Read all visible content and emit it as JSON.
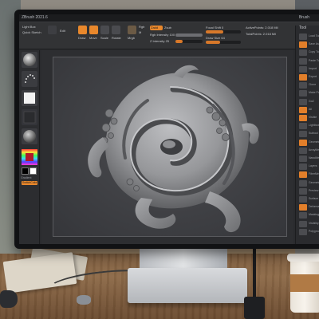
{
  "app": {
    "title": "ZBrush 2021.6",
    "menu_right": "Brush"
  },
  "toolbar": {
    "left_labels": [
      "Light Box",
      "Quick Sketch"
    ],
    "edit_label": "Edit",
    "draw_label": "Draw",
    "move_label": "Move",
    "scale_label": "Scale",
    "rotate_label": "Rotate",
    "mrgb_label": "Mrgb",
    "rgb_label": "Rgb",
    "m_label": "M",
    "zadd_label": "Zadd",
    "zsub_label": "Zsub",
    "focal_shift_label": "Focal Shift 0",
    "draw_size_label": "Draw Size 64",
    "rgb_intensity_label": "Rgb Intensity 100",
    "z_intensity_label": "Z Intensity 25",
    "active_points_label": "ActivePoints: 2.018 Mil",
    "total_points_label": "TotalPoints: 2.018 Mil"
  },
  "left_tray": {
    "tiles": [
      {
        "name": "brush-tile",
        "icon": "sphere-brush-icon"
      },
      {
        "name": "stroke-tile",
        "icon": "dots-stroke-icon"
      },
      {
        "name": "alpha-tile",
        "icon": "white-square-alpha-icon"
      },
      {
        "name": "texture-tile",
        "icon": "texture-off-icon"
      },
      {
        "name": "material-tile",
        "icon": "material-sphere-icon"
      }
    ],
    "color_picker": "color-picker",
    "swatch_main": "#000000",
    "swatch_secondary": "#ffffff",
    "gradient_label": "Gradient",
    "switch_label": "SwitchColor"
  },
  "right_tray": {
    "header": "Tool",
    "items": [
      "Load Tool",
      "Save As",
      "Copy Tool",
      "Paste Tool",
      "Import",
      "Export",
      "Clone",
      "Make PolyMesh3D",
      "GoZ",
      "All",
      "Visible",
      "Lightbox",
      "Subtool",
      "Geometry",
      "ArrayMesh",
      "NanoMesh",
      "Layers",
      "FiberMesh",
      "Geometry HD",
      "Preview",
      "Surface",
      "Deformation",
      "Masking",
      "Visibility",
      "Polygroups"
    ]
  },
  "colors": {
    "accent": "#e9882c",
    "ui_dark": "#2a2b2e",
    "canvas": "#3e3f43",
    "sculpt": "#9a9b9e"
  }
}
